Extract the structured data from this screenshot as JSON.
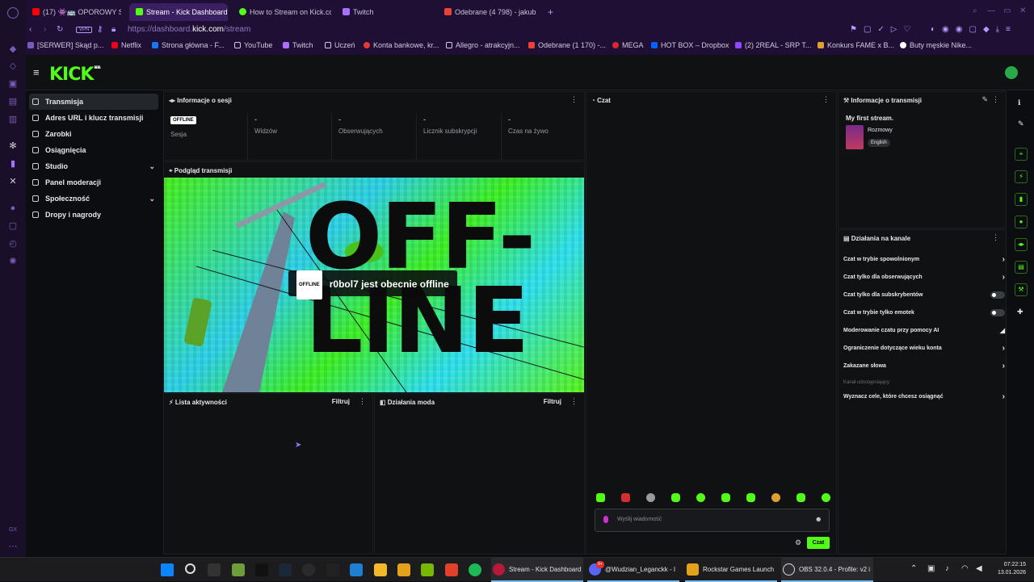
{
  "browser": {
    "tabs": [
      {
        "label": "(17) 👾🚌 OPOROWY SEC",
        "active": false
      },
      {
        "label": "Stream - Kick Dashboard",
        "active": true
      },
      {
        "label": "How to Stream on Kick.co",
        "active": false
      },
      {
        "label": "Twitch",
        "active": false
      },
      {
        "label": "Odebrane (4 798) - jakub",
        "active": false
      }
    ],
    "new_tab": "+",
    "vpn_label": "VPN",
    "url_prefix": "https://dashboard.",
    "url_host": "kick.com",
    "url_path": "/stream",
    "bookmarks": [
      "[SERWER] Skąd p...",
      "Netflix",
      "Strona główna - F...",
      "YouTube",
      "Twitch",
      "Uczeń",
      "Konta bankowe, kr...",
      "Allegro - atrakcyjn...",
      "Odebrane (1 170) -...",
      "MEGA",
      "HOT BOX – Dropbox",
      "(2) 2REAL - SRP T...",
      "Konkurs FAME x B...",
      "Buty męskie Nike..."
    ]
  },
  "kick": {
    "logo": "KICK",
    "logo_beta": "BETA",
    "nav": [
      {
        "label": "Transmisja",
        "active": true,
        "chevron": false
      },
      {
        "label": "Adres URL i klucz transmisji",
        "active": false,
        "chevron": false
      },
      {
        "label": "Zarobki",
        "active": false,
        "chevron": false
      },
      {
        "label": "Osiągnięcia",
        "active": false,
        "chevron": false
      },
      {
        "label": "Studio",
        "active": false,
        "chevron": true
      },
      {
        "label": "Panel moderacji",
        "active": false,
        "chevron": false
      },
      {
        "label": "Społeczność",
        "active": false,
        "chevron": true
      },
      {
        "label": "Dropy i nagrody",
        "active": false,
        "chevron": false
      }
    ],
    "session": {
      "title": "Informacje o sesji",
      "status_badge": "OFFLINE",
      "stats": [
        {
          "value": "",
          "label": "Sesja"
        },
        {
          "value": "-",
          "label": "Widzów"
        },
        {
          "value": "-",
          "label": "Obserwujących"
        },
        {
          "value": "-",
          "label": "Licznik subskrypcji"
        },
        {
          "value": "-",
          "label": "Czas na żywo"
        }
      ]
    },
    "preview": {
      "title": "Podgląd transmisji",
      "overlay_badge": "OFFLINE",
      "overlay_text": "r0bol7 jest obecnie offline",
      "art_text_1": "OFF-",
      "art_text_2": "LINE"
    },
    "activity": {
      "title": "Lista aktywności",
      "filter": "Filtruj"
    },
    "mod": {
      "title": "Działania moda",
      "filter": "Filtruj"
    },
    "chat": {
      "title": "Czat",
      "placeholder": "Wyślij wiadomość",
      "send": "Czat"
    },
    "stream_info": {
      "title": "Informacje o transmisji",
      "stream_title": "My first stream.",
      "category": "Rozmowy",
      "language": "English"
    },
    "channel": {
      "title": "Działania na kanale",
      "rows": [
        {
          "label": "Czat w trybie spowolnionym",
          "control": "chevron"
        },
        {
          "label": "Czat tylko dla obserwujących",
          "control": "chevron"
        },
        {
          "label": "Czat tylko dla subskrybentów",
          "control": "toggle"
        },
        {
          "label": "Czat w trybie tylko emotek",
          "control": "toggle"
        },
        {
          "label": "Moderowanie czatu przy pomocy AI",
          "control": "chart"
        },
        {
          "label": "Ograniczenie dotyczące wieku konta",
          "control": "chevron"
        },
        {
          "label": "Zakazane słowa",
          "control": "chevron"
        },
        {
          "label": "Kanał udostępniający",
          "control": "none"
        },
        {
          "label": "Wyznacz cele, które chcesz osiągnąć",
          "control": "chevron"
        }
      ]
    }
  },
  "taskbar": {
    "apps": [
      {
        "label": "Stream - Kick Dashboard"
      },
      {
        "label": "@Wudzian_Leganckk - I"
      },
      {
        "label": "Rockstar Games Launch"
      },
      {
        "label": "OBS 32.0.4 - Profile: v2 i"
      }
    ],
    "discord_badge": "9+",
    "time": "07:22:15",
    "date": "13.01.2026"
  },
  "colors": {
    "kick_green": "#53fc18",
    "browser_bg": "#1f0f35",
    "panel_bg": "#0f1113"
  }
}
